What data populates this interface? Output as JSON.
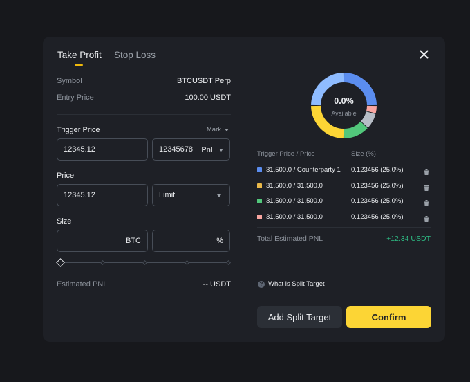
{
  "tabs": [
    {
      "label": "Take Profit",
      "active": true
    },
    {
      "label": "Stop Loss",
      "active": false
    }
  ],
  "info": {
    "symbol_label": "Symbol",
    "symbol_value": "BTCUSDT Perp",
    "entry_label": "Entry Price",
    "entry_value": "100.00 USDT"
  },
  "trigger": {
    "label": "Trigger Price",
    "mark_label": "Mark",
    "price_value": "12345.12",
    "pnl_value": "12345678",
    "pnl_unit": "PnL"
  },
  "price": {
    "label": "Price",
    "value": "12345.12",
    "type": "Limit"
  },
  "size": {
    "label": "Size",
    "btc_value": "",
    "btc_unit": "BTC",
    "pct_value": "",
    "pct_unit": "%",
    "slider_percent": 0
  },
  "estimated_pnl": {
    "label": "Estimated PNL",
    "value": "-- USDT"
  },
  "donut": {
    "percent": "0.0%",
    "caption": "Available",
    "segments": [
      {
        "color": "#fcd535",
        "share": 25
      },
      {
        "color": "#8fbcff",
        "share": 25
      },
      {
        "color": "#5b8def",
        "share": 25
      },
      {
        "color": "#f8a5a0",
        "share": 4
      },
      {
        "color": "#b7bdc6",
        "share": 8
      },
      {
        "color": "#52c77b",
        "share": 13
      }
    ]
  },
  "split_table": {
    "headers": [
      "Trigger Price / Price",
      "Size (%)"
    ],
    "rows": [
      {
        "color": "#5b8def",
        "price": "31,500.0 / Counterparty 1",
        "size": "0.123456 (25.0%)"
      },
      {
        "color": "#e9b94a",
        "price": "31,500.0 / 31,500.0",
        "size": "0.123456 (25.0%)"
      },
      {
        "color": "#52c77b",
        "price": "31,500.0 / 31,500.0",
        "size": "0.123456 (25.0%)"
      },
      {
        "color": "#f8a5a0",
        "price": "31,500.0 / 31,500.0",
        "size": "0.123456 (25.0%)"
      }
    ]
  },
  "total_pnl": {
    "label": "Total Estimated PNL",
    "value": "+12.34 USDT"
  },
  "help": {
    "icon": "?",
    "label": "What is Split Target"
  },
  "buttons": {
    "add_split": "Add Split Target",
    "confirm": "Confirm"
  },
  "colors": {
    "accent_yellow": "#fcd535",
    "positive_green": "#2ebd85",
    "modal_bg": "#1e2026"
  }
}
